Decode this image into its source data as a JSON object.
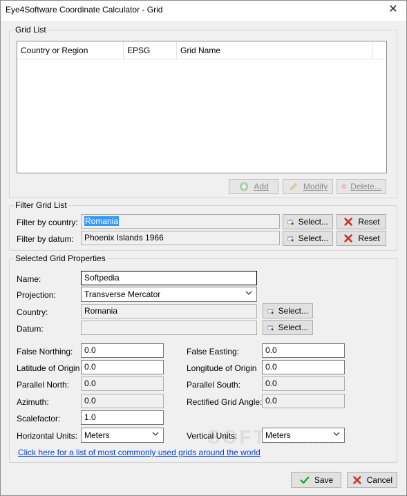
{
  "window": {
    "title": "Eye4Software Coordinate Calculator - Grid"
  },
  "grid_list": {
    "label": "Grid List",
    "columns": [
      "Country or Region",
      "EPSG",
      "Grid Name"
    ],
    "rows": [],
    "add_label": "Add",
    "modify_label": "Modify",
    "delete_label": "Delete..."
  },
  "filter": {
    "label": "Filter Grid List",
    "country_label": "Filter by country:",
    "country_value": "Romania",
    "datum_label": "Filter by datum:",
    "datum_value": "Phoenix Islands 1966",
    "select_label": "Select...",
    "reset_label": "Reset"
  },
  "props": {
    "label": "Selected Grid Properties",
    "name_label": "Name:",
    "name_value": "Softpedia",
    "projection_label": "Projection:",
    "projection_value": "Transverse Mercator",
    "country_label": "Country:",
    "country_value": "Romania",
    "datum_label": "Datum:",
    "datum_value": "",
    "select_label": "Select...",
    "false_northing_label": "False Northing:",
    "false_northing_value": "0.0",
    "false_easting_label": "False Easting:",
    "false_easting_value": "0.0",
    "lat_origin_label": "Latitude of Origin",
    "lat_origin_value": "0.0",
    "lon_origin_label": "Longitude of Origin",
    "lon_origin_value": "0.0",
    "parallel_north_label": "Parallel North:",
    "parallel_north_value": "0.0",
    "parallel_south_label": "Parallel South:",
    "parallel_south_value": "0.0",
    "azimuth_label": "Azimuth:",
    "azimuth_value": "0.0",
    "rect_angle_label": "Rectified Grid Angle:",
    "rect_angle_value": "0.0",
    "scalefactor_label": "Scalefactor:",
    "scalefactor_value": "1.0",
    "h_units_label": "Horizontal Units:",
    "h_units_value": "Meters",
    "v_units_label": "Vertical Units:",
    "v_units_value": "Meters"
  },
  "link_text": "Click here for a list of most commonly used grids around the world",
  "watermark": "SOFTPEDIA",
  "footer": {
    "save_label": "Save",
    "cancel_label": "Cancel"
  },
  "colors": {
    "link": "#0645d5",
    "selection": "#3399ff",
    "ok_green": "#2e9a2e",
    "cancel_red": "#d42a2a"
  }
}
